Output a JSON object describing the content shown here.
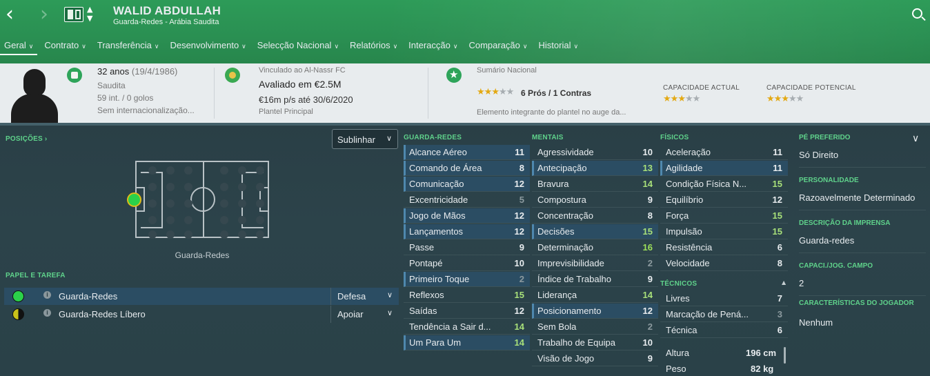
{
  "header": {
    "player_name": "WALID ABDULLAH",
    "player_sub": "Guarda-Redes - Arábia Saudita",
    "tabs": [
      {
        "label": "Geral"
      },
      {
        "label": "Contrato"
      },
      {
        "label": "Transferência"
      },
      {
        "label": "Desenvolvimento"
      },
      {
        "label": "Selecção Nacional"
      },
      {
        "label": "Relatórios"
      },
      {
        "label": "Interacção"
      },
      {
        "label": "Comparação"
      },
      {
        "label": "Historial"
      }
    ]
  },
  "summary": {
    "age": "32 anos",
    "dob": "(19/4/1986)",
    "nationality": "Saudita",
    "caps": "59 int. / 0 golos",
    "intl_status": "Sem internacionalização...",
    "club_line": "Vinculado ao Al-Nassr FC",
    "value": "Avaliado em €2.5M",
    "wage": "€16m p/s até 30/6/2020",
    "squad": "Plantel Principal",
    "national_summary_label": "Sumário Nacional",
    "pros_cons": "6 Prós / 1 Contras",
    "national_stars": 3,
    "national_desc": "Elemento integrante do plantel no auge da...",
    "current_ability_label": "CAPACIDADE ACTUAL",
    "current_ability_stars": 3,
    "potential_ability_label": "CAPACIDADE POTENCIAL",
    "potential_ability_stars": 3
  },
  "positions": {
    "heading": "POSIÇÕES",
    "highlight_dropdown": "Sublinhar",
    "position_label": "Guarda-Redes"
  },
  "roles": {
    "heading": "PAPEL E TAREFA",
    "items": [
      {
        "name": "Guarda-Redes",
        "duty": "Defesa",
        "color": "#2bd14a"
      },
      {
        "name": "Guarda-Redes Líbero",
        "duty": "Apoiar",
        "color": "#c9c21a"
      }
    ]
  },
  "attributes": {
    "gk_heading": "GUARDA-REDES",
    "goalkeeping": [
      {
        "name": "Alcance Aéreo",
        "value": "11"
      },
      {
        "name": "Comando de Área",
        "value": "8"
      },
      {
        "name": "Comunicação",
        "value": "12"
      },
      {
        "name": "Excentricidade",
        "value": "5"
      },
      {
        "name": "Jogo de Mãos",
        "value": "12"
      },
      {
        "name": "Lançamentos",
        "value": "12"
      },
      {
        "name": "Passe",
        "value": "9"
      },
      {
        "name": "Pontapé",
        "value": "10"
      },
      {
        "name": "Primeiro Toque",
        "value": "2"
      },
      {
        "name": "Reflexos",
        "value": "15"
      },
      {
        "name": "Saídas",
        "value": "12"
      },
      {
        "name": "Tendência a Sair d...",
        "value": "14"
      },
      {
        "name": "Um Para Um",
        "value": "14"
      }
    ],
    "mental_heading": "MENTAIS",
    "mental": [
      {
        "name": "Agressividade",
        "value": "10"
      },
      {
        "name": "Antecipação",
        "value": "13"
      },
      {
        "name": "Bravura",
        "value": "14"
      },
      {
        "name": "Compostura",
        "value": "9"
      },
      {
        "name": "Concentração",
        "value": "8"
      },
      {
        "name": "Decisões",
        "value": "15"
      },
      {
        "name": "Determinação",
        "value": "16"
      },
      {
        "name": "Imprevisibilidade",
        "value": "2"
      },
      {
        "name": "Índice de Trabalho",
        "value": "9"
      },
      {
        "name": "Liderança",
        "value": "14"
      },
      {
        "name": "Posicionamento",
        "value": "12"
      },
      {
        "name": "Sem Bola",
        "value": "2"
      },
      {
        "name": "Trabalho de Equipa",
        "value": "10"
      },
      {
        "name": "Visão de Jogo",
        "value": "9"
      }
    ],
    "physical_heading": "FÍSICOS",
    "physical": [
      {
        "name": "Aceleração",
        "value": "11"
      },
      {
        "name": "Agilidade",
        "value": "11"
      },
      {
        "name": "Condição Física N...",
        "value": "15"
      },
      {
        "name": "Equilíbrio",
        "value": "12"
      },
      {
        "name": "Força",
        "value": "15"
      },
      {
        "name": "Impulsão",
        "value": "15"
      },
      {
        "name": "Resistência",
        "value": "6"
      },
      {
        "name": "Velocidade",
        "value": "8"
      }
    ],
    "technical_heading": "TÉCNICOS",
    "technical": [
      {
        "name": "Livres",
        "value": "7"
      },
      {
        "name": "Marcação de Pená...",
        "value": "3"
      },
      {
        "name": "Técnica",
        "value": "6"
      }
    ],
    "height_label": "Altura",
    "height_value": "196 cm",
    "weight_label": "Peso",
    "weight_value": "82 kg"
  },
  "info": {
    "preferred_foot_label": "PÉ PREFERIDO",
    "preferred_foot": "Só Direito",
    "personality_label": "PERSONALIDADE",
    "personality": "Razoavelmente Determinado",
    "media_label": "DESCRIÇÃO DA IMPRENSA",
    "media": "Guarda-redes",
    "field_ability_label": "CAPACI./JOG. CAMPO",
    "field_ability": "2",
    "traits_label": "CARACTERÍSTICAS DO JOGADOR",
    "traits": "Nenhum"
  },
  "colors": {
    "header_green": "#2a8f52",
    "accent_green": "#5fd28b",
    "highlight_row": "#2b4d63",
    "star_gold": "#e3a913"
  },
  "icons": [
    "back-arrow-icon",
    "forward-arrow-icon",
    "club-crest-icon",
    "search-icon",
    "info-icon",
    "chevron-down-icon"
  ]
}
